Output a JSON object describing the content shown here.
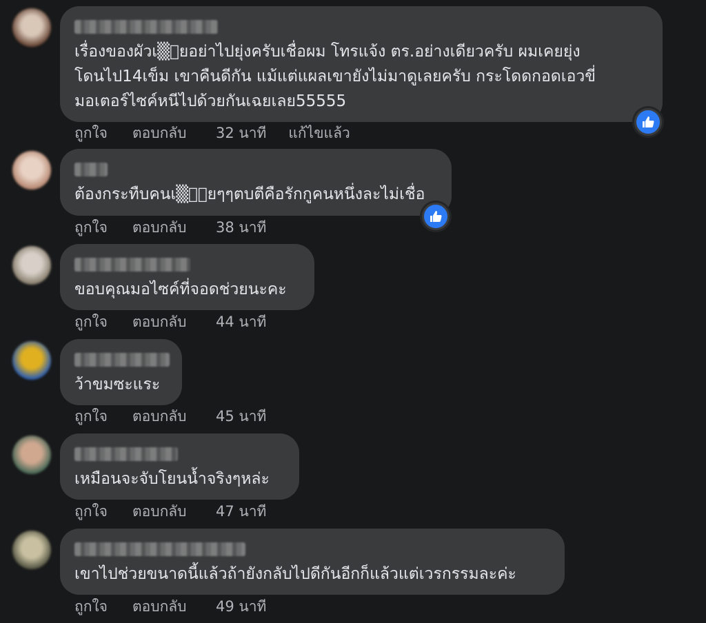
{
  "comments": [
    {
      "text": "เรื่องของผัวเ▒ียอย่าไปยุ่งครับเชื่อผม โทรแจ้ง ตร.อย่างเดียวครับ ผมเคยยุ่ง\nโดนไป14เข็ม เขาคืนดีกัน แม้แต่แผลเขายังไม่มาดูเลยครับ กระโดดกอดเอวขี่\nมอเตอร์ไซค์หนีไปด้วยกันเฉยเลย55555",
      "like_label": "ถูกใจ",
      "reply_label": "ตอบกลับ",
      "time": "32 นาที",
      "edited_label": "แก้ไขแล้ว",
      "reaction": "like-icon",
      "avatar_colors": [
        "#6b4a3a",
        "#d9c7b8"
      ]
    },
    {
      "text": "ต้องกระทืบคนเ▒ี้ยๆๆตบตีคือรักกูคนหนึ่งละไม่เชื่อ",
      "like_label": "ถูกใจ",
      "reply_label": "ตอบกลับ",
      "time": "38 นาที",
      "reaction": "like-icon",
      "avatar_colors": [
        "#b88a74",
        "#e8d2c4"
      ]
    },
    {
      "text": "ขอบคุณมอไซค์ที่จอดช่วยนะคะ",
      "like_label": "ถูกใจ",
      "reply_label": "ตอบกลับ",
      "time": "44 นาที",
      "avatar_colors": [
        "#8a8070",
        "#d8d0c8"
      ]
    },
    {
      "text": "ว้าขมซะแระ",
      "like_label": "ถูกใจ",
      "reply_label": "ตอบกลับ",
      "time": "45 นาที",
      "avatar_colors": [
        "#2f5fb0",
        "#e0b020"
      ]
    },
    {
      "text": "เหมือนจะจับโยนน้ำจริงๆหล่ะ",
      "like_label": "ถูกใจ",
      "reply_label": "ตอบกลับ",
      "time": "47 นาที",
      "avatar_colors": [
        "#4a6a58",
        "#d0a890"
      ]
    },
    {
      "text": "เขาไปช่วยขนาดนี้แล้วถ้ายังกลับไปดีกันอีกก็แล้วแต่เวรกรรมละค่ะ",
      "like_label": "ถูกใจ",
      "reply_label": "ตอบกลับ",
      "time": "49 นาที",
      "avatar_colors": [
        "#5a5a48",
        "#c8c0a0"
      ]
    }
  ]
}
